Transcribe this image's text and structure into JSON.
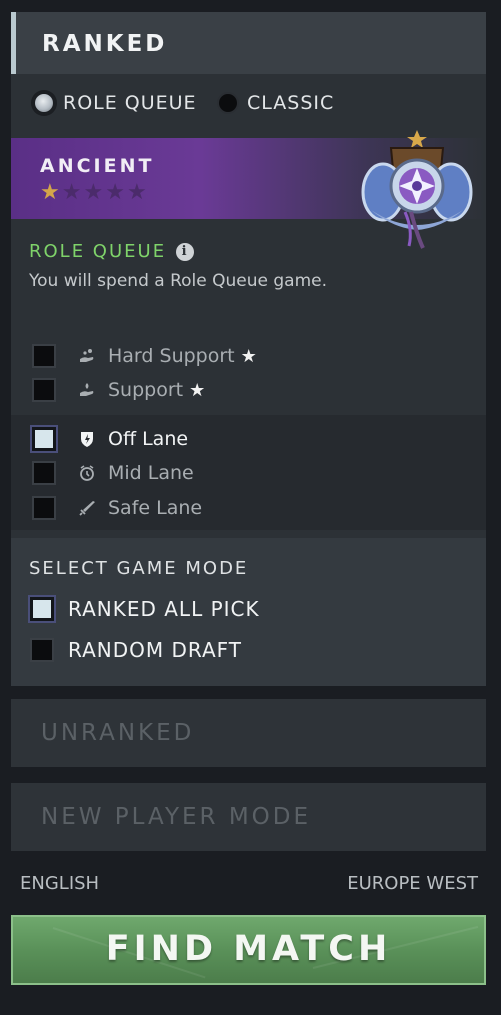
{
  "ranked": {
    "title": "RANKED",
    "queue_options": [
      {
        "label": "ROLE QUEUE",
        "selected": true
      },
      {
        "label": "CLASSIC",
        "selected": false
      }
    ],
    "medal": {
      "name": "ANCIENT",
      "stars_filled": 1,
      "stars_total": 5
    },
    "role_queue": {
      "title": "ROLE QUEUE",
      "description": "You will spend a Role Queue game."
    },
    "roles": [
      {
        "label": "Hard Support",
        "checked": false,
        "starred": true,
        "icon": "hard-support-icon"
      },
      {
        "label": "Support",
        "checked": false,
        "starred": true,
        "icon": "support-icon"
      },
      {
        "label": "Off Lane",
        "checked": true,
        "starred": false,
        "icon": "off-lane-icon"
      },
      {
        "label": "Mid Lane",
        "checked": false,
        "starred": false,
        "icon": "mid-lane-icon"
      },
      {
        "label": "Safe Lane",
        "checked": false,
        "starred": false,
        "icon": "safe-lane-icon"
      }
    ],
    "game_mode": {
      "title": "SELECT GAME MODE",
      "options": [
        {
          "label": "RANKED ALL PICK",
          "checked": true
        },
        {
          "label": "RANDOM DRAFT",
          "checked": false
        }
      ]
    }
  },
  "unranked_label": "UNRANKED",
  "new_player_label": "NEW PLAYER MODE",
  "footer": {
    "language": "ENGLISH",
    "region": "EUROPE WEST"
  },
  "find_match_label": "FIND MATCH",
  "colors": {
    "accent_green": "#7fd36a",
    "medal_purple": "#6a3a96",
    "star_gold": "#d3a54a",
    "find_match": "#5a9159"
  }
}
